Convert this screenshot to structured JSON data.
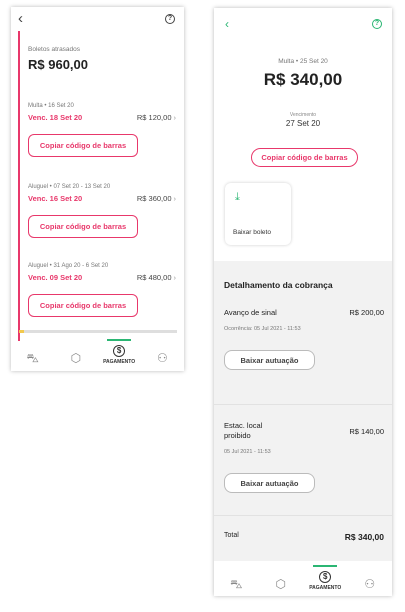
{
  "left_screen": {
    "overdue_label": "Boletos atrasados",
    "overdue_total": "R$ 960,00",
    "bills": [
      {
        "description": "Multa • 16 Set 20",
        "due": "Venc. 18 Set 20",
        "amount": "R$ 120,00",
        "button": "Copiar código de barras"
      },
      {
        "description": "Aluguel • 07 Set 20 - 13 Set 20",
        "due": "Venc. 16 Set 20",
        "amount": "R$ 360,00",
        "button": "Copiar código de barras"
      },
      {
        "description": "Aluguel • 31 Ago 20 - 6 Set 20",
        "due": "Venc. 09 Set 20",
        "amount": "R$ 480,00",
        "button": "Copiar código de barras"
      }
    ],
    "scroll_progress_pct": 3,
    "nav": {
      "active_label": "PAGAMENTO"
    }
  },
  "right_screen": {
    "description": "Multa • 25 Set 20",
    "amount": "R$ 340,00",
    "due_label": "Vencimento",
    "due_date": "27 Set 20",
    "copy_button": "Copiar código de barras",
    "download_label": "Baixar boleto",
    "detail_title": "Detalhamento da cobrança",
    "charges": [
      {
        "name": "Avanço de sinal",
        "amount": "R$ 200,00",
        "date": "Ocorrência: 05 Jul 2021 - 11:53",
        "button": "Baixar autuação"
      },
      {
        "name": "Estac. local proibido",
        "amount": "R$ 140,00",
        "date": "05 Jul 2021 - 11:53",
        "button": "Baixar autuação"
      }
    ],
    "total_label": "Total",
    "total_value": "R$ 340,00",
    "nav": {
      "active_label": "PAGAMENTO"
    }
  },
  "icons": {
    "back": "chevron-left-icon",
    "help": "help-circle-icon",
    "car": "car-icon",
    "box": "box-icon",
    "payment": "dollar-circle-icon",
    "profile": "user-icon",
    "download": "download-arrow-icon"
  },
  "colors": {
    "accent_red": "#e8386b",
    "accent_green": "#2bb673",
    "progress_yellow": "#f2c94c"
  }
}
